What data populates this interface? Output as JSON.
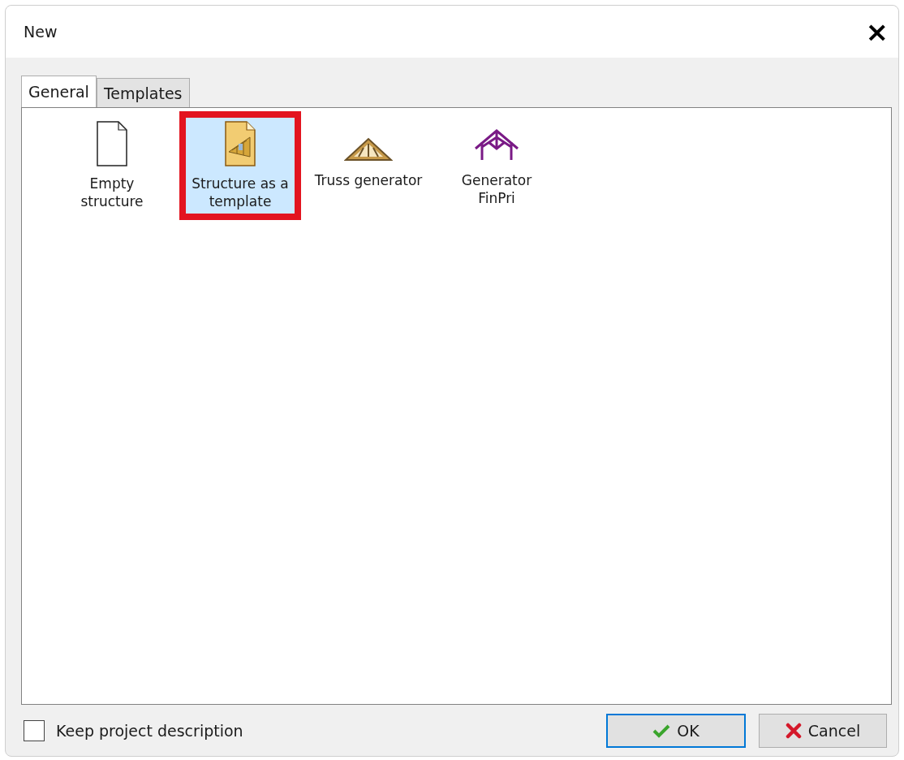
{
  "window": {
    "title": "New",
    "close": "×"
  },
  "tabs": [
    {
      "label": "General",
      "selected": true
    },
    {
      "label": "Templates",
      "selected": false
    }
  ],
  "items": [
    {
      "kind": "blank",
      "label": "Empty structure",
      "selected": false,
      "highlighted": false
    },
    {
      "kind": "template",
      "label": "Structure as a template",
      "selected": true,
      "highlighted": true
    },
    {
      "kind": "truss",
      "label": "Truss generator",
      "selected": false,
      "highlighted": false
    },
    {
      "kind": "frame",
      "label": "Generator FinPri",
      "selected": false,
      "highlighted": false
    }
  ],
  "keep_description": {
    "label": "Keep project description",
    "checked": false
  },
  "buttons": [
    {
      "kind": "ok",
      "label": "OK",
      "default": true
    },
    {
      "kind": "cancel",
      "label": "Cancel",
      "default": false
    }
  ]
}
